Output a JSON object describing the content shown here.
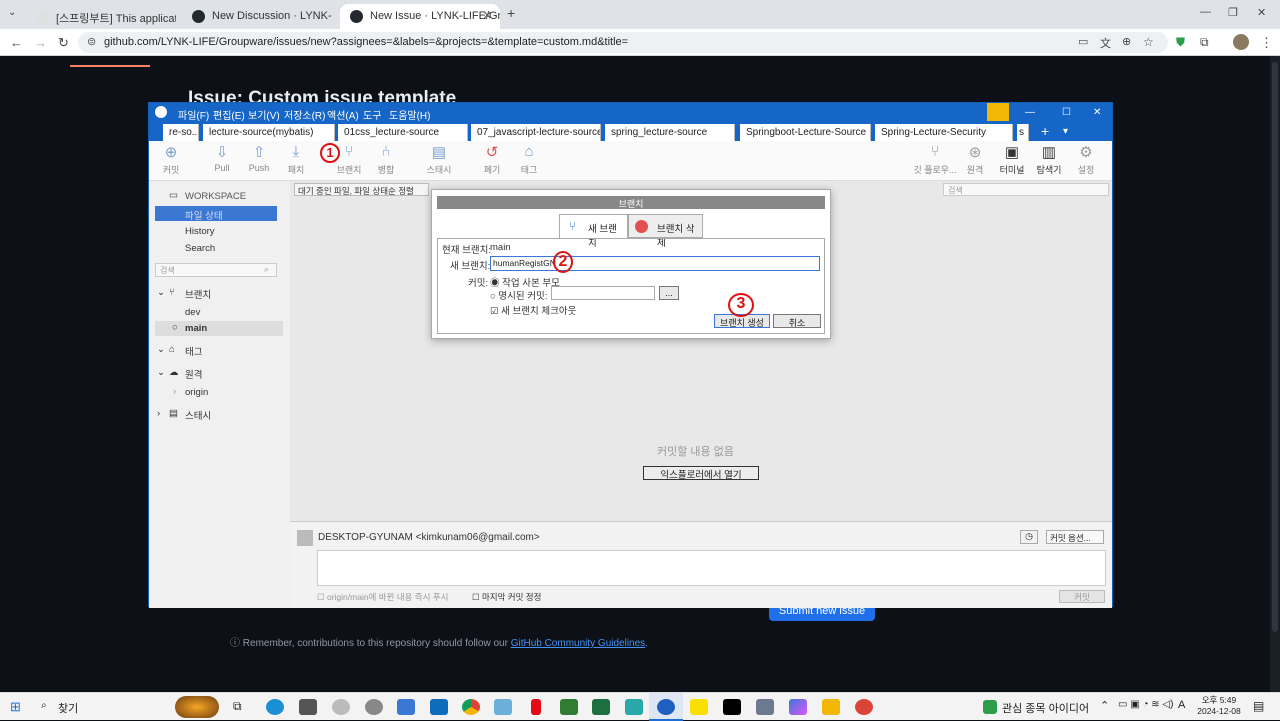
{
  "browser": {
    "tabs": [
      {
        "label": "[스프링부트] This application h"
      },
      {
        "label": "New Discussion · LYNK-LIFE"
      },
      {
        "label": "New Issue · LYNK-LIFE/Groupw"
      }
    ],
    "url": "github.com/LYNK-LIFE/Groupware/issues/new?assignees=&labels=&projects=&template=custom.md&title="
  },
  "github": {
    "title": "Issue: Custom issue template",
    "submit_label": "Submit new issue",
    "note_prefix": "Remember, contributions to this repository should follow our ",
    "note_link": "GitHub Community Guidelines",
    "note_suffix": "."
  },
  "sourcetree": {
    "menus": [
      "파일(F)",
      "편집(E)",
      "보기(V)",
      "저장소(R)",
      "액션(A)",
      "도구",
      "도움말(H)"
    ],
    "repo_tabs": [
      "re-so...",
      "lecture-source(mybatis)",
      "01css_lecture-source",
      "07_javascript-lecture-source",
      "spring_lecture-source",
      "Springboot-Lecture-Source",
      "Spring-Lecture-Security",
      "s"
    ],
    "toolbar": [
      "커밋",
      "Pull",
      "Push",
      "패치",
      "브랜치",
      "병합",
      "스태시",
      "폐기",
      "태그"
    ],
    "toolbar_right": [
      "깃 플로우...",
      "원격",
      "터미널",
      "탐색기",
      "설정"
    ],
    "sidebar": {
      "workspace": "WORKSPACE",
      "file_status": "파일 상태",
      "history": "History",
      "search": "Search",
      "search_placeholder": "검색",
      "branches": "브랜치",
      "branch_dev": "dev",
      "branch_main": "main",
      "tags": "태그",
      "remotes": "원격",
      "remote_origin": "origin",
      "stash": "스태시"
    },
    "filter_label": "대기 중인 파일, 파일 상태순 정렬",
    "search_placeholder": "검색",
    "empty_text": "커밋할 내용 없음",
    "open_explorer": "익스플로러에서 열기",
    "author": "DESKTOP-GYUNAM <kimkunam06@gmail.com>",
    "commit_options": "커밋 옵션...",
    "push_check": "origin/main에 바뀐 내용 즉시 푸시",
    "amend_check": "마지막 커밋 정정",
    "commit_button": "커밋"
  },
  "dialog": {
    "title": "브랜치",
    "tab_new": "새 브랜치",
    "tab_delete": "브랜치 삭제",
    "current_label": "현재 브랜치:",
    "current_value": "main",
    "new_label": "새 브랜치:",
    "new_value": "humanRegistGN",
    "commit_label": "커밋:",
    "radio_working": "작업 사본 부모",
    "radio_specified": "명시된 커밋:",
    "browse": "...",
    "checkout_label": "새 브랜치 체크아웃",
    "create_button": "브랜치 생성",
    "cancel_button": "취소"
  },
  "annotations": [
    "1",
    "2",
    "3"
  ],
  "taskbar": {
    "search": "찾기",
    "stock_text": "관심 종목 아이디어",
    "time": "오후 5:49",
    "date": "2024-12-08"
  }
}
